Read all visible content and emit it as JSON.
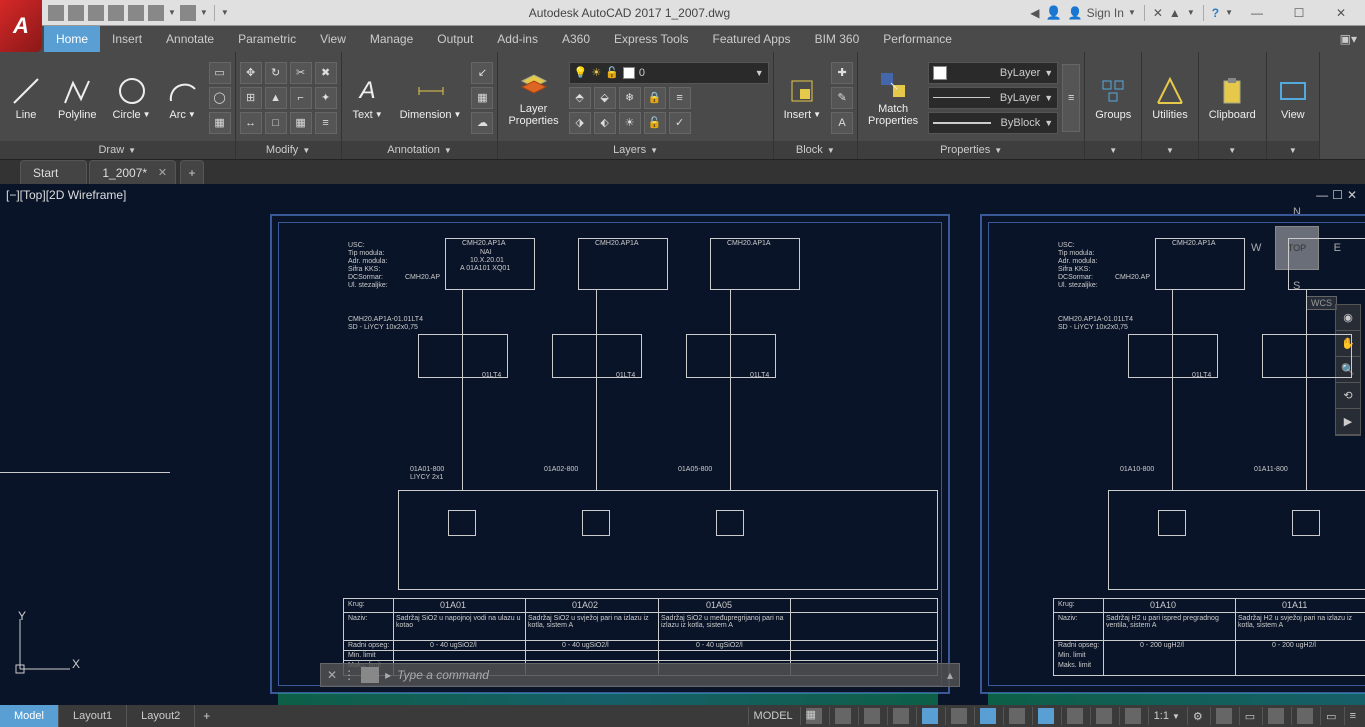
{
  "app": {
    "title": "Autodesk AutoCAD 2017   1_2007.dwg",
    "logo_letter": "A",
    "sign_in": "Sign In"
  },
  "tabs": {
    "items": [
      "Home",
      "Insert",
      "Annotate",
      "Parametric",
      "View",
      "Manage",
      "Output",
      "Add-ins",
      "A360",
      "Express Tools",
      "Featured Apps",
      "BIM 360",
      "Performance"
    ],
    "active": "Home"
  },
  "ribbon": {
    "draw": {
      "title": "Draw",
      "line": "Line",
      "polyline": "Polyline",
      "circle": "Circle",
      "arc": "Arc"
    },
    "modify": {
      "title": "Modify"
    },
    "annotation": {
      "title": "Annotation",
      "text": "Text",
      "dimension": "Dimension"
    },
    "layers": {
      "title": "Layers",
      "properties": "Layer\nProperties",
      "current": "0"
    },
    "block": {
      "title": "Block",
      "insert": "Insert"
    },
    "properties": {
      "title": "Properties",
      "match": "Match\nProperties",
      "bylayer": "ByLayer",
      "bylayer2": "ByLayer",
      "byblock": "ByBlock"
    },
    "groups": {
      "title": "Groups"
    },
    "utilities": {
      "title": "Utilities"
    },
    "clipboard": {
      "title": "Clipboard"
    },
    "view": {
      "title": "View"
    }
  },
  "filetabs": {
    "start": "Start",
    "file1": "1_2007*"
  },
  "viewport": {
    "label": "[−][Top][2D Wireframe]",
    "cube": "TOP",
    "compass": {
      "n": "N",
      "e": "E",
      "s": "S",
      "w": "W"
    },
    "wcs": "WCS"
  },
  "ucs": {
    "x": "X",
    "y": "Y"
  },
  "cmd": {
    "placeholder": "Type a command"
  },
  "layouttabs": {
    "model": "Model",
    "l1": "Layout1",
    "l2": "Layout2"
  },
  "status": {
    "model": "MODEL",
    "scale": "1:1"
  },
  "drawing": {
    "left_labels": [
      "USC:",
      "Tip modula:",
      "Adr. modula:",
      "Sifra KKS:",
      "DCSormar:",
      "Ul. stezaljke:"
    ],
    "cmh": "CMH20.AP",
    "module1": "CMH20.AP1A",
    "mod_sub1": "NAI",
    "mod_sub2": "10.X.20.01",
    "mod_sub3": "A  01A101  XQ01",
    "cable": "CMH20.AP1A-01.01LT4",
    "cable2": "SD - LiYCY 10x2x0,75",
    "lt4": "01LT4",
    "liycy": "LIYCY 2x1",
    "a01": "01A01-800",
    "a02": "01A02-800",
    "a05": "01A05-800",
    "a10": "01A10-800",
    "a11": "01A11-800",
    "krug": "Krug:",
    "naziv": "Naziv:",
    "radni": "Radni opseg:",
    "min": "Min. limit",
    "maks": "Maks. limit",
    "k01": "01A01",
    "k02": "01A02",
    "k05": "01A05",
    "k10": "01A10",
    "k11": "01A11",
    "desc01": "Sadržaj SiO2 u napojnoj vodi na ulazu u kotao",
    "desc02": "Sadržaj SiO2 u svježoj pari na izlazu iz kotla, sistem A",
    "desc05": "Sadržaj SiO2 u međupregrijanoj pari na izlazu iz kotla, sistem A",
    "desc10": "Sadržaj H2 u pari ispred pregradnog ventila, sistem A",
    "desc11": "Sadržaj H2 u svježoj pari na izlazu iz kotla, sistem A",
    "range1": "0 - 40 ugSiO2/l",
    "range2": "0 - 200 ugH2/l"
  }
}
